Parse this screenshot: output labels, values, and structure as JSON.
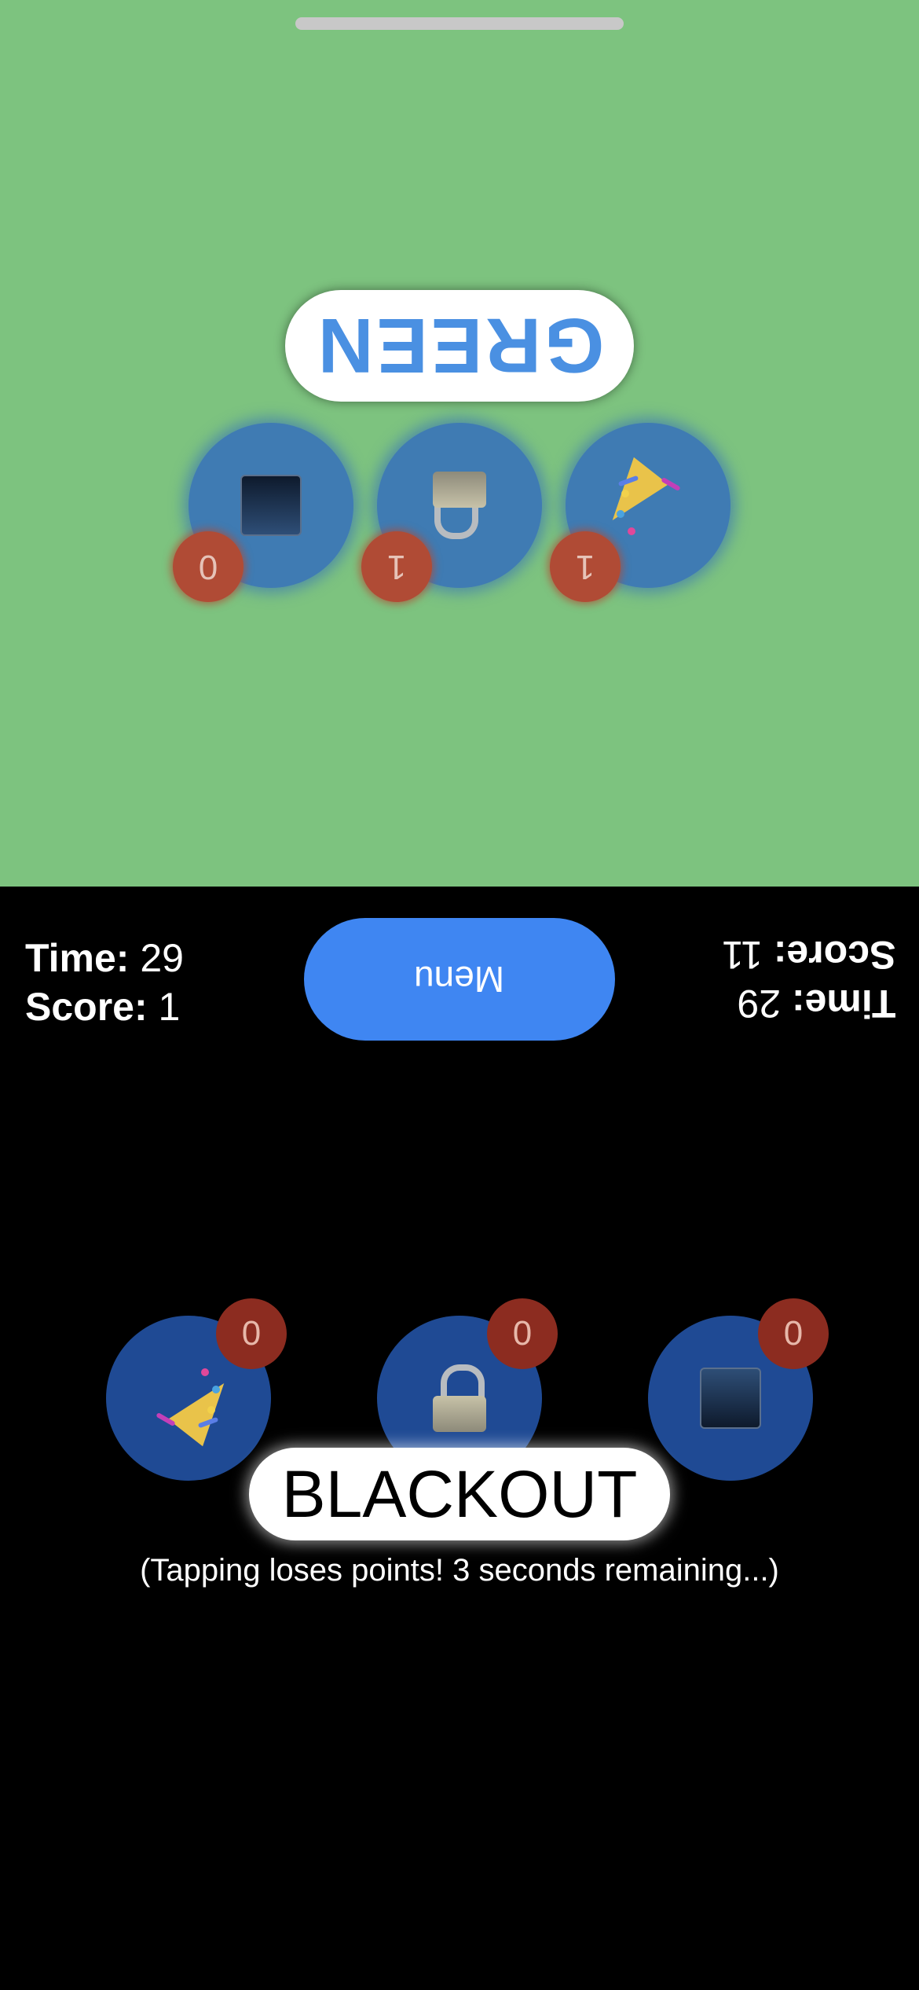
{
  "opponent": {
    "color_word": "GREEN",
    "color_word_color": "#4a90e2",
    "buttons": [
      {
        "icon": "party-popper-icon",
        "count": "1"
      },
      {
        "icon": "lock-icon",
        "count": "1"
      },
      {
        "icon": "blue-square-icon",
        "count": "0"
      }
    ],
    "hud": {
      "time_label": "Time:",
      "time_value": "29",
      "score_label": "Score:",
      "score_value": "11"
    }
  },
  "player": {
    "hud": {
      "time_label": "Time:",
      "time_value": "29",
      "score_label": "Score:",
      "score_value": "1"
    },
    "buttons": [
      {
        "icon": "party-popper-icon",
        "count": "0"
      },
      {
        "icon": "lock-icon",
        "count": "0"
      },
      {
        "icon": "blue-square-icon",
        "count": "0"
      }
    ],
    "color_word": "BLACKOUT",
    "hint": "(Tapping loses points! 3 seconds remaining...)"
  },
  "menu_label": "Menu",
  "colors": {
    "top_background": "#7dc37f",
    "bottom_background": "#000000",
    "menu_button": "#3f86f2",
    "badge": "#8c2c20"
  }
}
